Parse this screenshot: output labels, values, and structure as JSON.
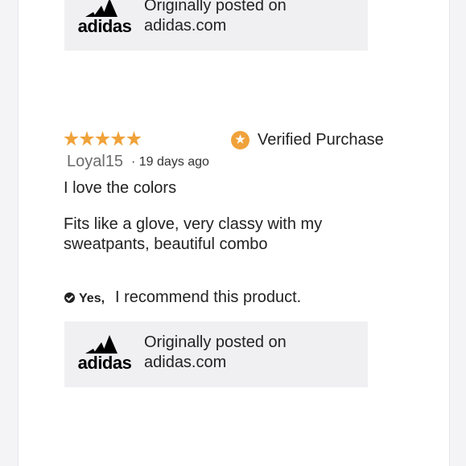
{
  "source_top": {
    "line1": "Originally posted on",
    "line2": "adidas.com",
    "logo_text": "adidas"
  },
  "review": {
    "rating": 5,
    "rating_max": 5,
    "verified_label": "Verified Purchase",
    "author": "Loyal15",
    "date": "· 19 days ago",
    "title": "I love the colors",
    "body": "Fits like a glove, very classy with my sweatpants, beautiful combo",
    "recommend_yes": "Yes,",
    "recommend_text": "I recommend this product."
  },
  "source_bottom": {
    "line1": "Originally posted on",
    "line2": "adidas.com",
    "logo_text": "adidas"
  },
  "colors": {
    "star": "#f0a23a",
    "box_bg": "#f0f0f3",
    "text": "#222222"
  },
  "icons": {
    "stars": "star-icon",
    "verified": "verified-star-badge-icon",
    "check": "check-circle-icon",
    "logo": "adidas-logo"
  }
}
